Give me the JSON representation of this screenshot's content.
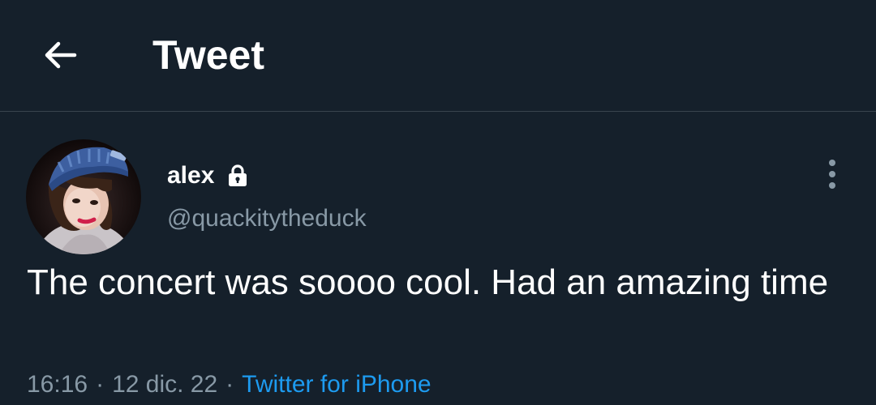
{
  "header": {
    "back_icon": "arrow-left-icon",
    "title": "Tweet"
  },
  "tweet": {
    "author": {
      "display_name": "alex",
      "handle": "@quackitytheduck",
      "protected_icon": "lock-icon",
      "avatar_icon": "avatar-photo"
    },
    "more_icon": "more-vertical-icon",
    "text": "The concert was soooo cool. Had an amazing time",
    "time": "16:16",
    "date": "12 dic. 22",
    "separator": "·",
    "source": "Twitter for iPhone"
  },
  "colors": {
    "background": "#15202b",
    "primary_text": "#ffffff",
    "secondary_text": "#8899a6",
    "link": "#1d9bf0",
    "divider": "#38444d"
  }
}
